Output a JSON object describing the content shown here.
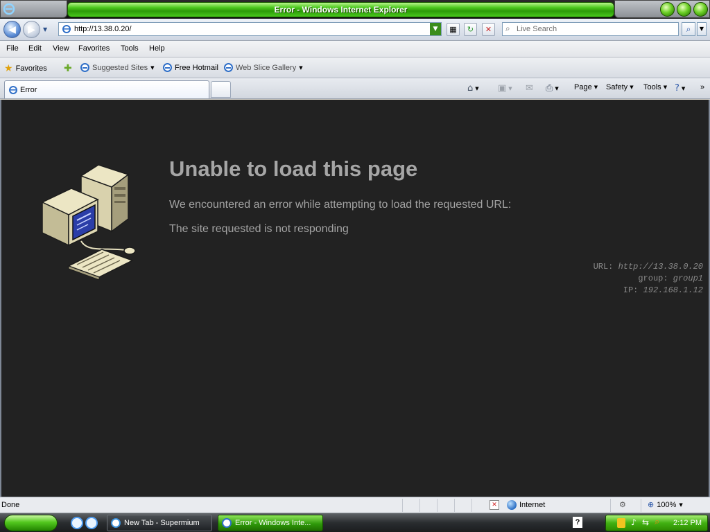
{
  "window": {
    "title": "Error - Windows Internet Explorer"
  },
  "address": {
    "url": "http://13.38.0.20/"
  },
  "search": {
    "placeholder": "Live Search"
  },
  "menu": {
    "items": [
      "File",
      "Edit",
      "View",
      "Favorites",
      "Tools",
      "Help"
    ]
  },
  "favorites_bar": {
    "favorites_label": "Favorites",
    "items": [
      "Suggested Sites",
      "Free Hotmail",
      "Web Slice Gallery"
    ]
  },
  "tabs": {
    "active_label": "Error"
  },
  "command_bar": {
    "page": "Page",
    "safety": "Safety",
    "tools": "Tools",
    "more": "»"
  },
  "content": {
    "title": "Unable to load this page",
    "message": "We encountered an error while attempting to load the requested URL:",
    "detail": "The site requested is not responding",
    "info": {
      "url_label": "URL:",
      "url_value": "http://13.38.0.20",
      "group_label": "group:",
      "group_value": "group1",
      "ip_label": "IP:",
      "ip_value": "192.168.1.12"
    }
  },
  "status": {
    "text": "Done",
    "zone": "Internet",
    "zoom": "100%"
  },
  "taskbar": {
    "tasks": [
      "New Tab - Supermium",
      "Error - Windows Inte..."
    ],
    "clock": "2:12 PM"
  },
  "colors": {
    "content_bg": "#222222",
    "title_green": "#4bc81c",
    "text_gray": "#a6a6a6"
  }
}
